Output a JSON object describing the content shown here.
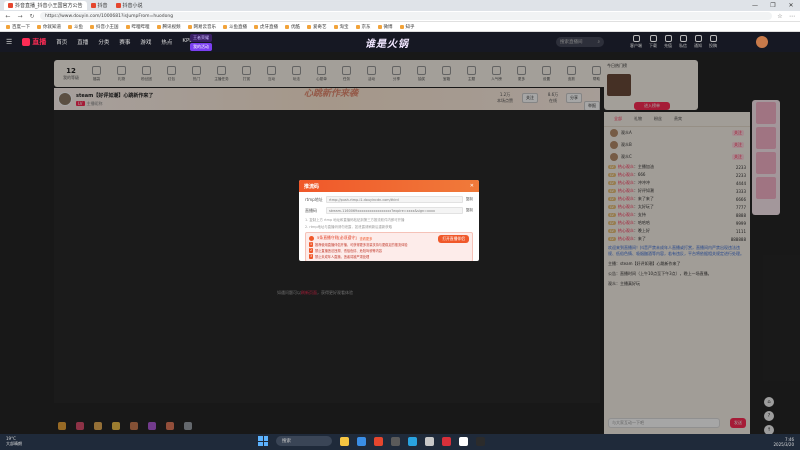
{
  "browser": {
    "tabs": [
      {
        "label": "抖音直播_抖音小王国官方公告"
      },
      {
        "label": "抖音"
      },
      {
        "label": "抖音小说"
      }
    ],
    "window_controls": [
      "—",
      "❐",
      "✕"
    ],
    "url": "https://www.douyin.com/1000681?isJumpFrom=huodong",
    "bookmarks": [
      "百度一下",
      "你就知道",
      "斗鱼",
      "抖音小王国",
      "哔哩哔哩",
      "腾讯视频",
      "网易云音乐",
      "斗鱼直播",
      "虎牙直播",
      "优酷",
      "爱奇艺",
      "淘宝",
      "京东",
      "微博",
      "知乎"
    ]
  },
  "site": {
    "logo": "直播",
    "nav": [
      "首页",
      "直播",
      "分类",
      "赛事",
      "游戏",
      "热点",
      "KPL"
    ],
    "event_line1": "王者荣耀",
    "event_pill1": "王者荣耀",
    "event_pill2": "我的活动",
    "center_title": "谁是火锅",
    "search_placeholder": "搜索直播间",
    "header_icons": [
      "客户端",
      "下载",
      "充值",
      "私信",
      "通知",
      "投稿"
    ]
  },
  "gift_bar": {
    "level": "12",
    "level_label": "我的等级",
    "items": [
      "福袋",
      "礼物",
      "粉丝团",
      "红包",
      "热门",
      "主播任务",
      "打赏",
      "互动",
      "玩法",
      "心愿单",
      "任务",
      "活动",
      "分享",
      "抽奖",
      "宝箱",
      "主题",
      "人气榜",
      "更多",
      "设置",
      "皮肤",
      "帮助"
    ],
    "pc_button": "PC客户端",
    "pc_sub": "下载电脑版"
  },
  "streamer": {
    "title": "steam【好评如潮】心跳新作来了",
    "tag": "LV",
    "sub": "主播昵称",
    "banner": "心跳新作来袭",
    "stats": [
      {
        "value": "1.2万",
        "label": "本场点赞"
      },
      {
        "value": "8.6万",
        "label": "在线"
      }
    ],
    "buttons": [
      "关注",
      "分享",
      "举报"
    ]
  },
  "player": {
    "message_prefix": "如遇问题可以",
    "message_link": "刷新页面",
    "message_suffix": "，获得更好观看体验"
  },
  "rank_card": {
    "title": "今日热门榜",
    "button": "进入榜单"
  },
  "chat": {
    "tabs": [
      "全部",
      "礼物",
      "粉丝",
      "贵宾"
    ],
    "viewers": [
      {
        "name": "观众A",
        "badge": "关注"
      },
      {
        "name": "观众B",
        "badge": "关注"
      },
      {
        "name": "观众C",
        "badge": "关注"
      }
    ],
    "messages": [
      {
        "user": "热心观众",
        "text": "主播加油",
        "count": "2233"
      },
      {
        "user": "热心观众",
        "text": "666",
        "count": "2233"
      },
      {
        "user": "热心观众",
        "text": "冲冲冲",
        "count": "4444"
      },
      {
        "user": "热心观众",
        "text": "好评如潮",
        "count": "3333"
      },
      {
        "user": "热心观众",
        "text": "来了来了",
        "count": "6666"
      },
      {
        "user": "热心观众",
        "text": "太好玩了",
        "count": "7777"
      },
      {
        "user": "热心观众",
        "text": "支持",
        "count": "8888"
      },
      {
        "user": "热心观众",
        "text": "哈哈哈",
        "count": "9999"
      },
      {
        "user": "热心观众",
        "text": "晚上好",
        "count": "1111"
      },
      {
        "user": "热心观众",
        "text": "来了",
        "count": "888888"
      }
    ],
    "system_note": "欢迎来到直播间！抖音严禁未成年人直播或打赏，直播间内严禁出现违法违规、低俗色情、吸烟酗酒等内容，若有违反，平台将依据相关规定进行处理。",
    "plain_lines": [
      "主播：steam【好评如潮】心跳新作来了",
      "公告：直播时间（上午10点至下午3点），晚上一场直播。",
      "观众：主播真好玩"
    ],
    "input_placeholder": "与大家互动一下吧",
    "send": "发送"
  },
  "side_controls": [
    "⌂",
    "?",
    "↑"
  ],
  "modal": {
    "title": "推流码",
    "close": "✕",
    "server_label": "rtmp地址",
    "server_value": "rtmp://push-rtmp-l1.douyincdn.com/third",
    "copy1": "复制",
    "key_label": "直播码",
    "key_value": "stream-1160069xxxxxxxxxxxxxxxxx?expire=xxxx&sign=xxxx",
    "copy2": "复制",
    "tip1": "1. 复制上方 rtmp 地址和直播码粘贴到第三方推流软件内即可开播",
    "tip2": "2. rtmp地址与直播码请勿泄露，如泄露请刷新后重新获取",
    "notice_title": "5条直播守则[必须遵守]",
    "notice_sub": "查看更多",
    "open_button": "打开直播伴侣",
    "lines": [
      {
        "k": "1",
        "text": "推荐使用直播伴侣开播，可获得更多流量扶持与更稳定的推流体验"
      },
      {
        "k": "2",
        "text": "禁止直播违法违规、低俗色情、危险驾驶等内容"
      },
      {
        "k": "3",
        "text": "禁止未成年人直播，违者将被严肃处理"
      }
    ]
  },
  "taskbar": {
    "weather_temp": "19°C",
    "weather_desc": "大部晴朗",
    "search": "搜索",
    "time": "7:46",
    "date": "2025/3/20"
  }
}
